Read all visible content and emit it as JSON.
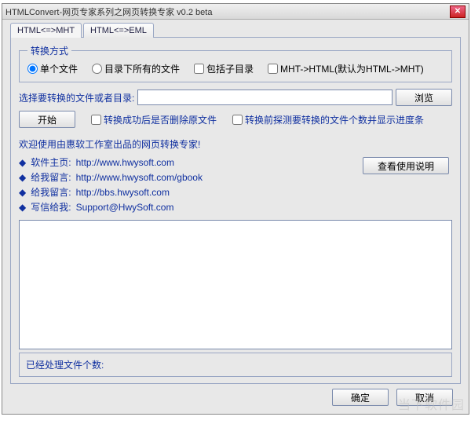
{
  "window": {
    "title": "HTMLConvert-网页专家系列之网页转换专家 v0.2 beta"
  },
  "tabs": [
    {
      "label": "HTML<=>MHT"
    },
    {
      "label": "HTML<=>EML"
    }
  ],
  "convmode": {
    "legend": "转换方式",
    "options": [
      "单个文件",
      "目录下所有的文件",
      "包括子目录",
      "MHT->HTML(默认为HTML->MHT)"
    ]
  },
  "pathrow": {
    "label": "选择要转换的文件或者目录:",
    "value": "",
    "browse": "浏览"
  },
  "startrow": {
    "start": "开始",
    "check1": "转换成功后是否删除原文件",
    "check2": "转换前探测要转换的文件个数并显示进度条"
  },
  "welcome": "欢迎使用由惠软工作室出品的网页转换专家!",
  "links": [
    {
      "label": "软件主页:",
      "url": "http://www.hwysoft.com"
    },
    {
      "label": "给我留言:",
      "url": "http://www.hwysoft.com/gbook"
    },
    {
      "label": "给我留言:",
      "url": "http://bbs.hwysoft.com"
    },
    {
      "label": "写信给我:",
      "url": "Support@HwySoft.com"
    }
  ],
  "help_button": "查看使用说明",
  "log_text": "",
  "processed_label": "已经处理文件个数:",
  "buttons": {
    "ok": "确定",
    "cancel": "取消"
  },
  "watermark": "当下软件园"
}
